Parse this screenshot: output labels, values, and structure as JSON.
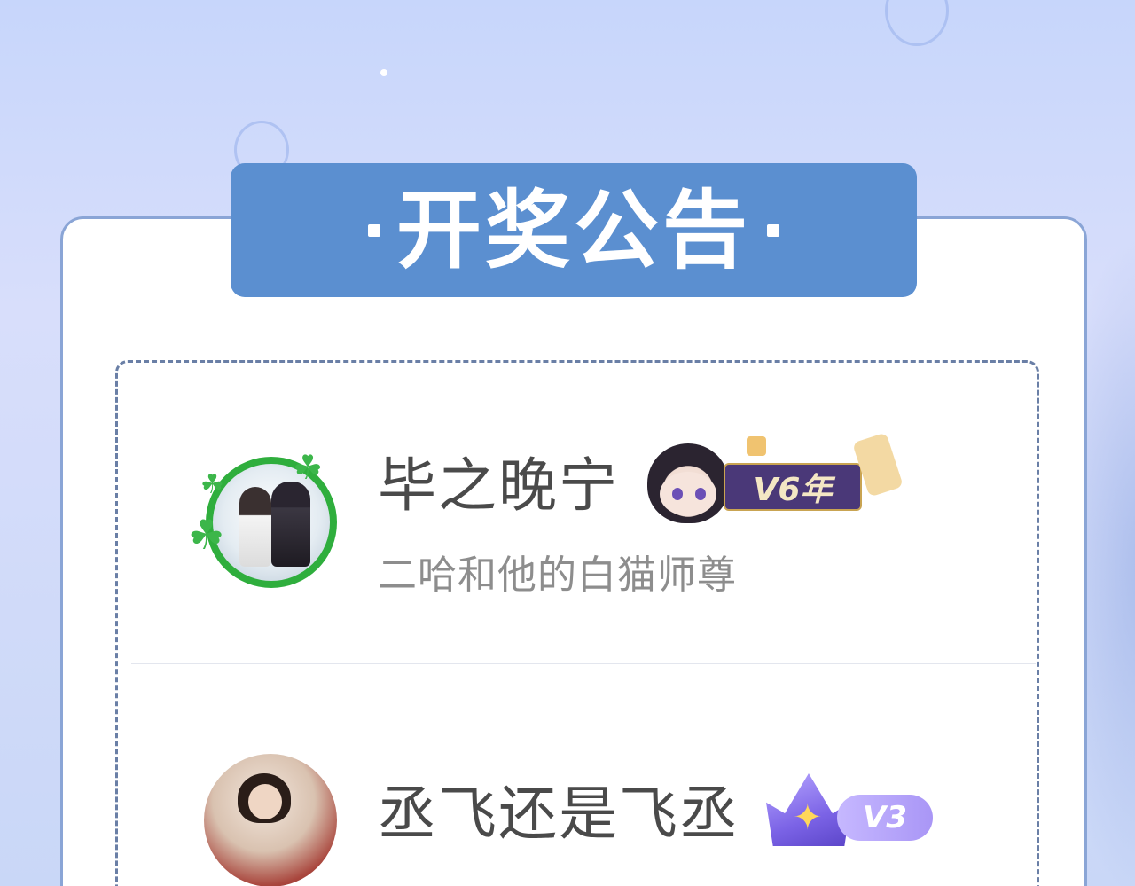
{
  "announcement": {
    "title": "开奖公告"
  },
  "winners": [
    {
      "username": "毕之晚宁",
      "subtitle": "二哈和他的白猫师尊",
      "badge": "V6年"
    },
    {
      "username": "丞飞还是飞丞",
      "badge": "V3"
    }
  ],
  "colors": {
    "banner": "#5b8fd0",
    "card_border": "#8aa5d6",
    "avatar_ring": "#2fae3d",
    "badge_v6": "#4a3878",
    "badge_v3": "#a996f6"
  },
  "icons": {
    "clover": "four-leaf-clover-icon",
    "crown": "crown-icon",
    "star": "star-icon",
    "lantern": "lantern-icon"
  }
}
